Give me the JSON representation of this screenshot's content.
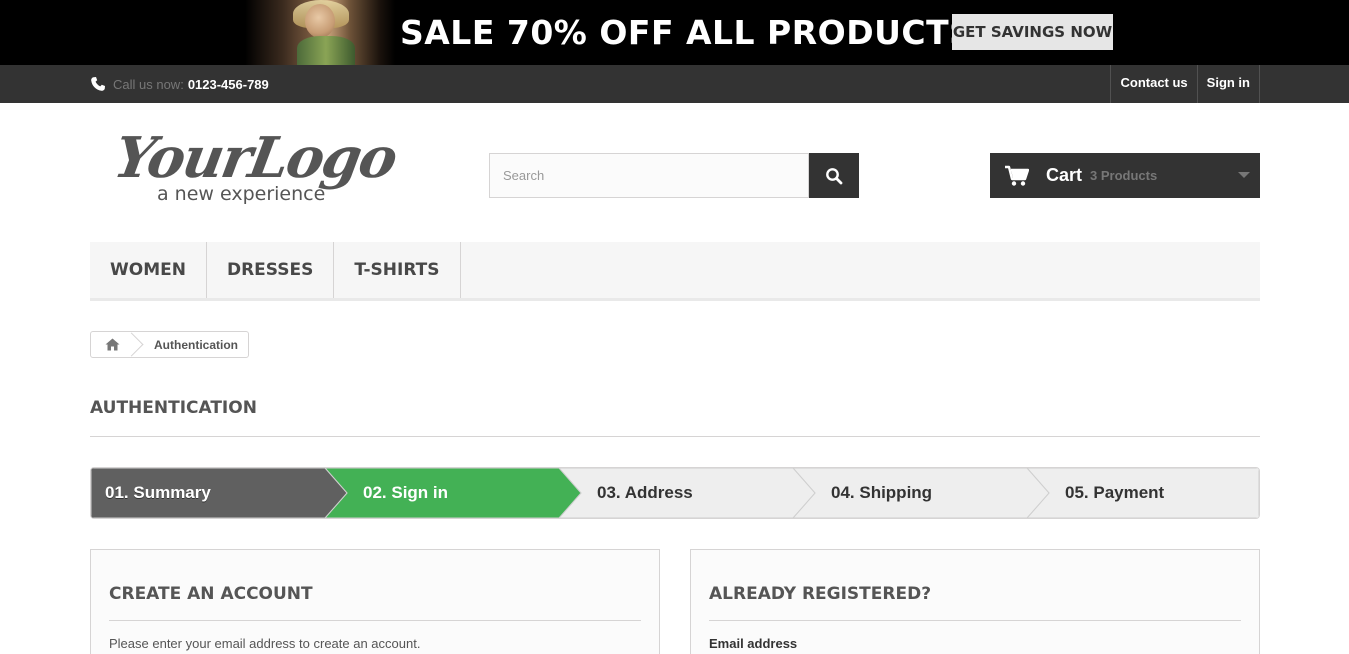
{
  "banner": {
    "headline": "SALE 70% OFF ALL PRODUCTS",
    "cta_label": "GET SAVINGS NOW"
  },
  "topbar": {
    "phone_prefix": "Call us now:",
    "phone_number": "0123-456-789",
    "links": [
      "Contact us",
      "Sign in"
    ]
  },
  "header": {
    "logo_script": "YourLogo",
    "logo_tagline": "a new experience",
    "search_placeholder": "Search",
    "cart_label": "Cart",
    "cart_count": "3 Products"
  },
  "menu": {
    "items": [
      "WOMEN",
      "DRESSES",
      "T-SHIRTS"
    ]
  },
  "breadcrumb": {
    "current": "Authentication"
  },
  "page": {
    "heading": "AUTHENTICATION"
  },
  "steps": {
    "items": [
      "01. Summary",
      "02. Sign in",
      "03. Address",
      "04. Shipping",
      "05. Payment"
    ],
    "done_color": "#606060",
    "active_color": "#43b155",
    "todo_color": "#eeeeee"
  },
  "create_account": {
    "title": "CREATE AN ACCOUNT",
    "text": "Please enter your email address to create an account."
  },
  "already_registered": {
    "title": "ALREADY REGISTERED?",
    "email_label": "Email address"
  }
}
